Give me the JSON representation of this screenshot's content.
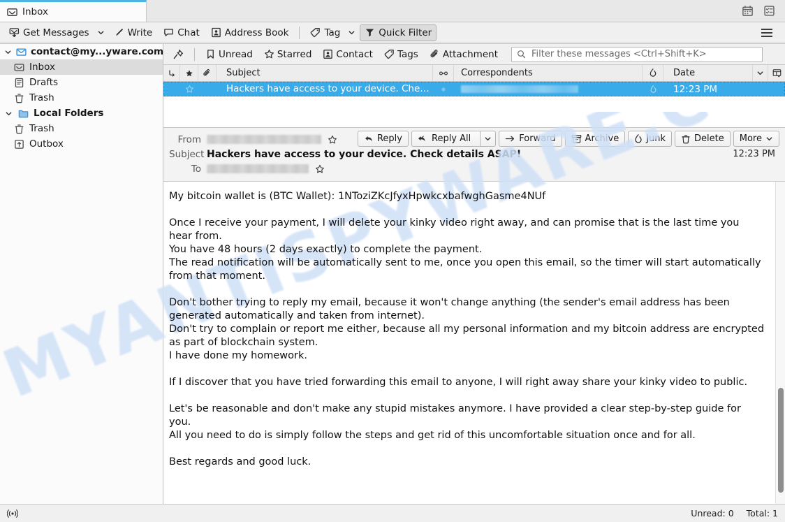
{
  "tab": {
    "label": "Inbox",
    "icon": "inbox-icon"
  },
  "titlebar_icons": {
    "calendar": "calendar-icon",
    "tasks": "tasks-icon",
    "app_menu": "hamburger-menu-icon"
  },
  "toolbar": {
    "get_messages": "Get Messages",
    "write": "Write",
    "chat": "Chat",
    "address_book": "Address Book",
    "tag": "Tag",
    "quick_filter": "Quick Filter"
  },
  "quick_filter_bar": {
    "pin": "pin-icon",
    "unread": "Unread",
    "starred": "Starred",
    "contact": "Contact",
    "tags": "Tags",
    "attachment": "Attachment",
    "search_placeholder": "Filter these messages <Ctrl+Shift+K>",
    "search_value": ""
  },
  "folder_pane": {
    "accounts": [
      {
        "name": "contact@my...yware.com",
        "icon": "mail-account-icon",
        "expanded": true,
        "children": [
          {
            "name": "Inbox",
            "icon": "inbox-icon",
            "selected": true
          },
          {
            "name": "Drafts",
            "icon": "drafts-icon",
            "selected": false
          },
          {
            "name": "Trash",
            "icon": "trash-icon",
            "selected": false
          }
        ]
      },
      {
        "name": "Local Folders",
        "icon": "folder-icon",
        "expanded": true,
        "children": [
          {
            "name": "Trash",
            "icon": "trash-icon",
            "selected": false
          },
          {
            "name": "Outbox",
            "icon": "outbox-icon",
            "selected": false
          }
        ]
      }
    ]
  },
  "thread_list": {
    "columns": {
      "thread": "thread-column-icon",
      "star": "star-column-icon",
      "attachment": "attachment-column-icon",
      "subject": "Subject",
      "unread": "unread-column-icon",
      "correspondents": "Correspondents",
      "junk": "junk-column-icon",
      "date": "Date",
      "sort_indicator": "chevron-down-icon",
      "column_picker": "column-picker-icon"
    },
    "rows": [
      {
        "subject": "Hackers have access to your device. Chec...",
        "correspondents": "",
        "date": "12:23 PM",
        "selected": true,
        "starred": false
      }
    ]
  },
  "message_header": {
    "from_label": "From",
    "from_value": "",
    "subject_label": "Subject",
    "subject_value": "Hackers have access to your device. Check details ASAP!",
    "to_label": "To",
    "to_value": "",
    "time": "12:23 PM",
    "actions": {
      "reply": "Reply",
      "reply_all": "Reply All",
      "forward": "Forward",
      "archive": "Archive",
      "junk": "Junk",
      "delete": "Delete",
      "more": "More"
    }
  },
  "message_body": {
    "lines": [
      "My bitcoin wallet is (BTC Wallet): 1NToziZKcJfyxHpwkcxbafwghGasme4NUf",
      "",
      "Once I receive your payment, I will delete your kinky video right away, and can promise that is the last time you hear from.",
      "You have 48 hours (2 days exactly) to complete the payment.",
      "The read notification will be automatically sent to me, once you open this email, so the timer will start automatically from that moment.",
      "",
      "Don't bother trying to reply my email, because it won't change anything (the sender's email address has been generated automatically and taken from internet).",
      "Don't try to complain or report me either, because all my personal information and my bitcoin address are encrypted as part of blockchain system.",
      "I have done my homework.",
      "",
      "If I discover that you have tried forwarding this email to anyone, I will right away share your kinky video to public.",
      "",
      "Let's be reasonable and don't make any stupid mistakes anymore. I have provided a clear step-by-step guide for you.",
      "All you need to do is simply follow the steps and get rid of this uncomfortable situation once and for all.",
      "",
      "Best regards and good luck."
    ]
  },
  "watermark": {
    "text": "MYANTISPYWARE.COM"
  },
  "status_bar": {
    "connection_icon": "connection-icon",
    "unread": "Unread: 0",
    "total": "Total: 1"
  },
  "colors": {
    "selection_blue": "#3aabe9",
    "tab_accent": "#4cb3e3",
    "watermark": "#cfe0f7"
  }
}
